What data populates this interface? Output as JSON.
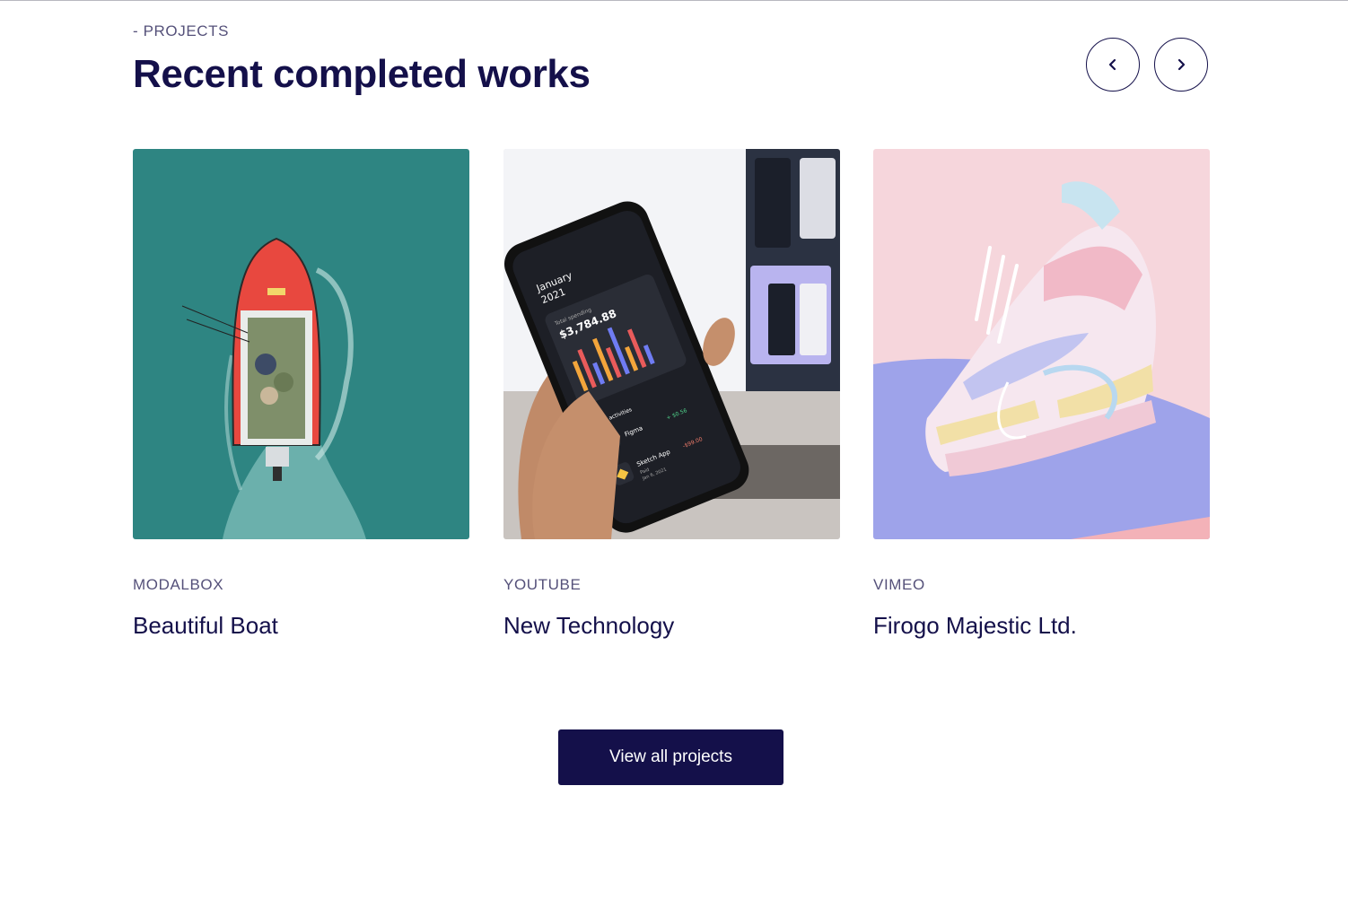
{
  "section": {
    "eyebrow": "- PROJECTS",
    "title": "Recent completed works"
  },
  "nav": {
    "prev_icon": "chevron-left-icon",
    "next_icon": "chevron-right-icon"
  },
  "projects": [
    {
      "category": "MODALBOX",
      "title": "Beautiful Boat"
    },
    {
      "category": "YOUTUBE",
      "title": "New Technology"
    },
    {
      "category": "VIMEO",
      "title": "Firogo Majestic Ltd."
    }
  ],
  "phone_screen": {
    "month": "January",
    "year": "2021",
    "label": "Total spending",
    "amount": "$3,784.88",
    "activities_label": "Latest activities",
    "item_1": "Figma",
    "item_1_amount": "+ $0.56",
    "item_2": "Sketch App",
    "item_2_sub": "Paid",
    "item_2_date": "Jan 6, 2021",
    "item_2_amount": "-$99.00"
  },
  "cta": {
    "label": "View all projects"
  },
  "colors": {
    "navy": "#14104a",
    "muted": "#55517a",
    "teal": "#2e8582",
    "pastel_pink": "#f6d6dc",
    "pastel_purple": "#9ea3ea"
  }
}
